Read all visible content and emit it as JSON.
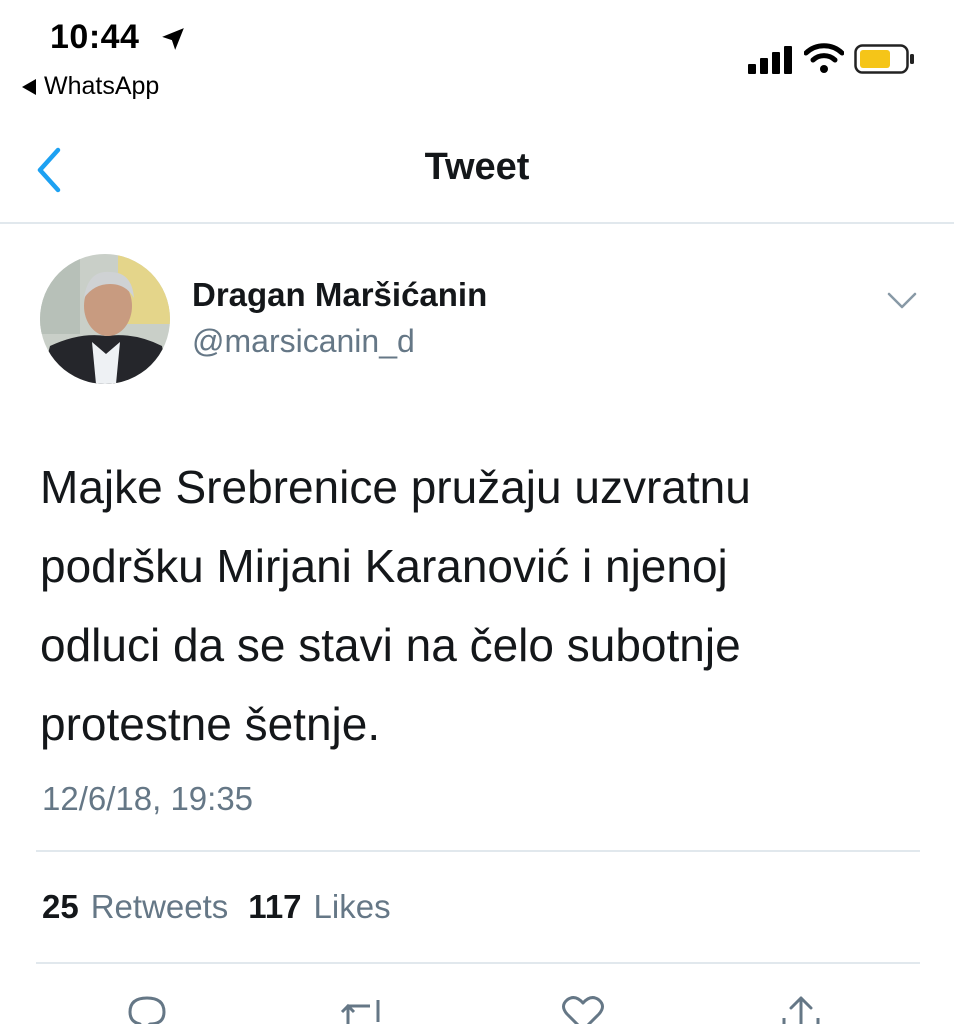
{
  "status_bar": {
    "time": "10:44",
    "back_app_label": "WhatsApp"
  },
  "nav": {
    "title": "Tweet"
  },
  "tweet": {
    "display_name": "Dragan Maršićanin",
    "handle": "@marsicanin_d",
    "text_lines": [
      "Majke Srebrenice pružaju uzvratnu",
      "podršku Mirjani Karanović i njenoj",
      "odluci da se stavi na čelo subotnje",
      "protestne šetnje."
    ],
    "timestamp": "12/6/18, 19:35"
  },
  "stats": {
    "retweets_count": "25",
    "retweets_label": "Retweets",
    "likes_count": "117",
    "likes_label": "Likes"
  },
  "colors": {
    "accent": "#1da1f2",
    "secondary_text": "#657786",
    "divider": "#e1e8ed",
    "battery": "#f5c518"
  },
  "icons": {
    "location": "location-arrow-icon",
    "signal": "cellular-signal-icon",
    "wifi": "wifi-icon",
    "battery": "battery-icon",
    "back": "chevron-left-icon",
    "caret": "chevron-down-icon",
    "reply": "reply-icon",
    "retweet": "retweet-icon",
    "like": "heart-icon",
    "share": "share-icon"
  }
}
